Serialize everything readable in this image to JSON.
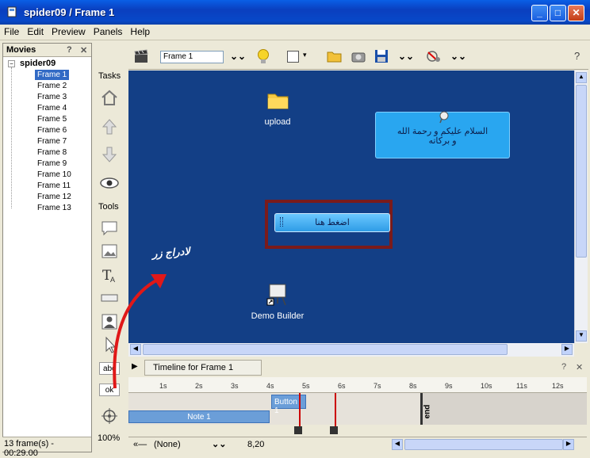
{
  "window": {
    "title": "spider09 / Frame 1"
  },
  "menu": {
    "items": [
      "File",
      "Edit",
      "Preview",
      "Panels",
      "Help"
    ]
  },
  "movies_panel": {
    "title": "Movies",
    "help": "?",
    "close": "✕",
    "root": "spider09",
    "frames": [
      "Frame 1",
      "Frame 2",
      "Frame 3",
      "Frame 4",
      "Frame 5",
      "Frame 6",
      "Frame 7",
      "Frame 8",
      "Frame 9",
      "Frame 10",
      "Frame 11",
      "Frame 12",
      "Frame 13"
    ],
    "selected_frame": "Frame 1"
  },
  "status": {
    "left": "13 frame(s) - 00:29.00",
    "zoom": "100%",
    "coords": "8,20",
    "layer": "(None)",
    "layer_prefix": "«—"
  },
  "tasks": {
    "tasks_label": "Tasks",
    "tools_label": "Tools",
    "abc_label": "abc",
    "ok_label": "ok"
  },
  "toolbar": {
    "frame_value": "Frame 1",
    "help": "?"
  },
  "canvas": {
    "upload_label": "upload",
    "callout_text": "السلام عليكم و رحمة الله و بركاته",
    "button_text": "اضغط هنا",
    "handwritten_note": "لادراج زر",
    "demo_builder_label": "Demo Builder"
  },
  "timeline": {
    "tab_label": "Timeline for Frame 1",
    "help": "?",
    "close": "✕",
    "ticks": [
      "1s",
      "2s",
      "3s",
      "4s",
      "5s",
      "6s",
      "7s",
      "8s",
      "9s",
      "10s",
      "11s",
      "12s"
    ],
    "button_item": "Button 1",
    "note_item": "Note 1",
    "end_label": "end"
  },
  "colors": {
    "canvas_bg": "#133f86",
    "selection": "#316ac5",
    "callout": "#29a6f0",
    "highlight_border": "#7a1b1b",
    "arrow": "#e01818"
  }
}
